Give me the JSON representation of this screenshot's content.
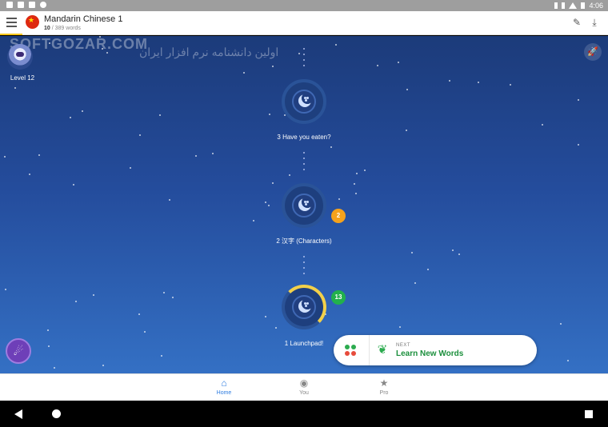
{
  "status_bar": {
    "time": "4:06"
  },
  "header": {
    "course_title": "Mandarin Chinese 1",
    "words_learned": "10",
    "words_total": "/ 389 words"
  },
  "watermark": {
    "brand": "SOFTGOZAR.COM",
    "tagline": "اولین دانشنامه نرم افزار ایران"
  },
  "user": {
    "level_label": "Level 12"
  },
  "levels": [
    {
      "label": "3 Have you eaten?",
      "badge": ""
    },
    {
      "label": "2 汉字 (Characters)",
      "badge": "2",
      "badge_color": "#f5a21c"
    },
    {
      "label": "1 Launchpad!",
      "badge": "13",
      "badge_color": "#22b14c",
      "progress": 0.45
    }
  ],
  "next_card": {
    "eyebrow": "NEXT",
    "title": "Learn New Words"
  },
  "tabs": [
    {
      "label": "Home",
      "icon": "home-icon",
      "active": true
    },
    {
      "label": "You",
      "icon": "person-icon",
      "active": false
    },
    {
      "label": "Pro",
      "icon": "star-icon",
      "active": false
    }
  ],
  "colors": {
    "accent": "#2f7de0",
    "green": "#22b14c",
    "orange": "#f5a21c",
    "gold": "#f2d04a"
  }
}
